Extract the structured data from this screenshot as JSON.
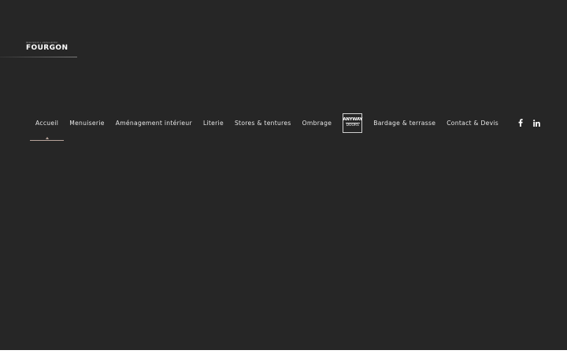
{
  "logo": {
    "tagline": "MENUISERIE & AMÉNAGEMENT",
    "wordmark": "FOURGON"
  },
  "nav": {
    "items": [
      {
        "label": "Accueil",
        "active": true
      },
      {
        "label": "Menuiserie"
      },
      {
        "label": "Aménagement intérieur"
      },
      {
        "label": "Literie"
      },
      {
        "label": "Stores & tentures"
      },
      {
        "label": "Ombrage"
      }
    ],
    "brand_badge": {
      "line1": "ANYWAY",
      "line2": "DOORS"
    },
    "items_after": [
      {
        "label": "Bardage & terrasse"
      },
      {
        "label": "Contact & Devis"
      }
    ]
  },
  "social": {
    "icons": [
      "facebook-icon",
      "linkedin-icon"
    ]
  },
  "colors": {
    "background": "#262626",
    "text": "#e6e6e6",
    "accent": "#b7a39a",
    "footer_strip": "#ffffff"
  }
}
